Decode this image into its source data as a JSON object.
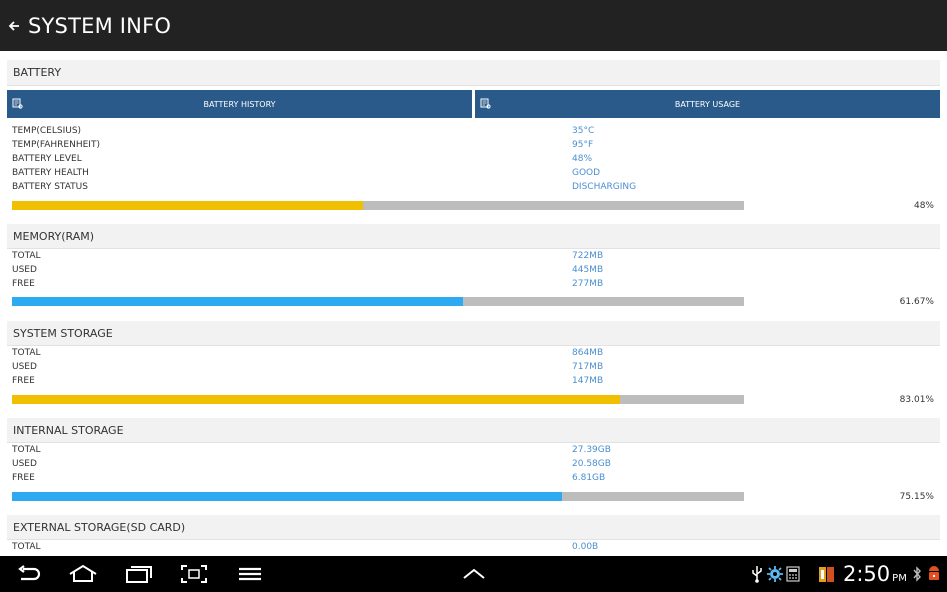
{
  "header": {
    "title": "SYSTEM INFO"
  },
  "battery": {
    "title": "BATTERY",
    "history_button": "BATTERY HISTORY",
    "usage_button": "BATTERY USAGE",
    "rows": [
      {
        "label": "TEMP(CELSIUS)",
        "value": "35°C"
      },
      {
        "label": "TEMP(FAHRENHEIT)",
        "value": "95°F"
      },
      {
        "label": "BATTERY LEVEL",
        "value": "48%"
      },
      {
        "label": "BATTERY HEALTH",
        "value": "GOOD"
      },
      {
        "label": "BATTERY STATUS",
        "value": "DISCHARGING"
      }
    ],
    "percent": "48%",
    "fraction": 0.48,
    "bar_color": "#f0c000"
  },
  "memory": {
    "title": "MEMORY(RAM)",
    "rows": [
      {
        "label": "TOTAL",
        "value": "722MB"
      },
      {
        "label": "USED",
        "value": "445MB"
      },
      {
        "label": "FREE",
        "value": "277MB"
      }
    ],
    "percent": "61.67%",
    "fraction": 0.6167,
    "bar_color": "#2eaaf0"
  },
  "system_storage": {
    "title": "SYSTEM STORAGE",
    "rows": [
      {
        "label": "TOTAL",
        "value": "864MB"
      },
      {
        "label": "USED",
        "value": "717MB"
      },
      {
        "label": "FREE",
        "value": "147MB"
      }
    ],
    "percent": "83.01%",
    "fraction": 0.8301,
    "bar_color": "#f0c000"
  },
  "internal_storage": {
    "title": "INTERNAL STORAGE",
    "rows": [
      {
        "label": "TOTAL",
        "value": "27.39GB"
      },
      {
        "label": "USED",
        "value": "20.58GB"
      },
      {
        "label": "FREE",
        "value": "6.81GB"
      }
    ],
    "percent": "75.15%",
    "fraction": 0.7515,
    "bar_color": "#2eaaf0"
  },
  "external_storage": {
    "title": "EXTERNAL STORAGE(SD CARD)",
    "rows": [
      {
        "label": "TOTAL",
        "value": "0.00B"
      }
    ]
  },
  "statusbar": {
    "time": "2:50",
    "ampm": "PM"
  },
  "icons": {
    "back": "back-arrow-icon",
    "nav_back": "nav-back-icon",
    "home": "home-icon",
    "recent": "recent-apps-icon",
    "screenshot": "screenshot-icon",
    "menu": "menu-icon",
    "up": "chevron-up-icon",
    "usb": "usb-icon",
    "settings": "settings-icon",
    "calculator": "calculator-icon",
    "battery": "battery-icon",
    "bluetooth": "bluetooth-icon",
    "android": "android-icon"
  }
}
